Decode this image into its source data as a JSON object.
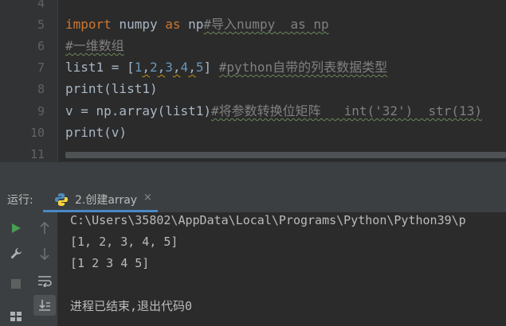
{
  "editor": {
    "lines": [
      {
        "num": "4"
      },
      {
        "num": "5",
        "text": "import numpy as np#导入numpy  as np"
      },
      {
        "num": "6",
        "text": "#一维数组"
      },
      {
        "num": "7",
        "text": "list1 = [1,2,3,4,5] #python自带的列表数据类型"
      },
      {
        "num": "8",
        "text": "print(list1)"
      },
      {
        "num": "9",
        "text": "v = np.array(list1)#将参数转换位矩阵   int('32')  str(13)"
      },
      {
        "num": "10",
        "text": "print(v)"
      },
      {
        "num": "11",
        "text": ""
      }
    ],
    "tokens": {
      "import_kw": "import",
      "numpy_name": " numpy ",
      "as_kw": "as",
      "np_name": " np",
      "comment5": "#导入numpy  as np",
      "comment6": "#一维数组",
      "list_prefix": "list1 = [",
      "n1": "1",
      "n2": "2",
      "n3": "3",
      "n4": "4",
      "n5": "5",
      "comma": ",",
      "list_suffix": "] ",
      "comment7": "#python自带的列表数据类型",
      "print_list": "print(list1)",
      "assign_v": "v = np.array(list1)",
      "comment9": "#将参数转换位矩阵   int('32')  str(13)",
      "print_v": "print(v)"
    }
  },
  "run_panel": {
    "label": "运行:",
    "tab_label": "2.创建array",
    "tab_close": "×",
    "console_lines": [
      "C:\\Users\\35802\\AppData\\Local\\Programs\\Python\\Python39\\p",
      "[1, 2, 3, 4, 5]",
      "[1 2 3 4 5]",
      "",
      "进程已结束,退出代码0"
    ]
  },
  "colors": {
    "keyword": "#cc7832",
    "comment": "#808080",
    "number": "#6897bb",
    "text": "#a9b7c6",
    "run_green": "#499c54",
    "tab_accent": "#4a88c7"
  }
}
